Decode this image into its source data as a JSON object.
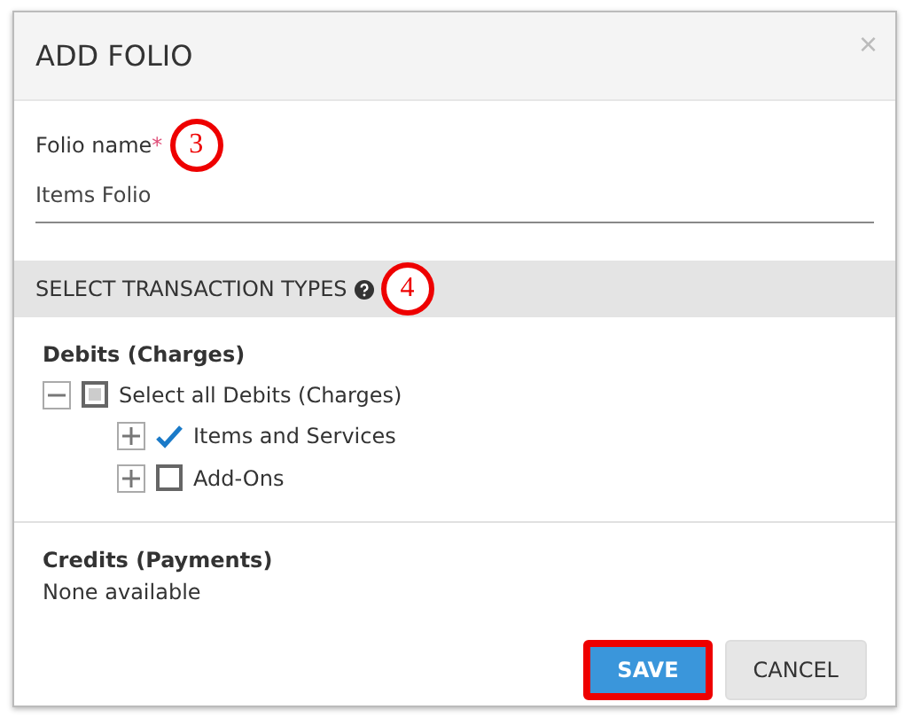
{
  "dialog": {
    "title": "ADD FOLIO",
    "close": "×"
  },
  "folio_name": {
    "label": "Folio name",
    "required_mark": "*",
    "value": "Items Folio",
    "callout": "3"
  },
  "section": {
    "title": "SELECT TRANSACTION TYPES",
    "callout": "4"
  },
  "debits": {
    "heading": "Debits (Charges)",
    "tree": [
      {
        "label": "Select all Debits (Charges)",
        "expanded": true,
        "checked": false,
        "partial": true,
        "children": [
          {
            "label": "Items and Services",
            "expanded": false,
            "checked": true
          },
          {
            "label": "Add-Ons",
            "expanded": false,
            "checked": false
          }
        ]
      }
    ]
  },
  "credits": {
    "heading": "Credits (Payments)",
    "text": "None available"
  },
  "buttons": [
    {
      "label": "SAVE",
      "kind": "primary",
      "highlighted": true
    },
    {
      "label": "CANCEL",
      "kind": "secondary",
      "highlighted": false
    }
  ]
}
